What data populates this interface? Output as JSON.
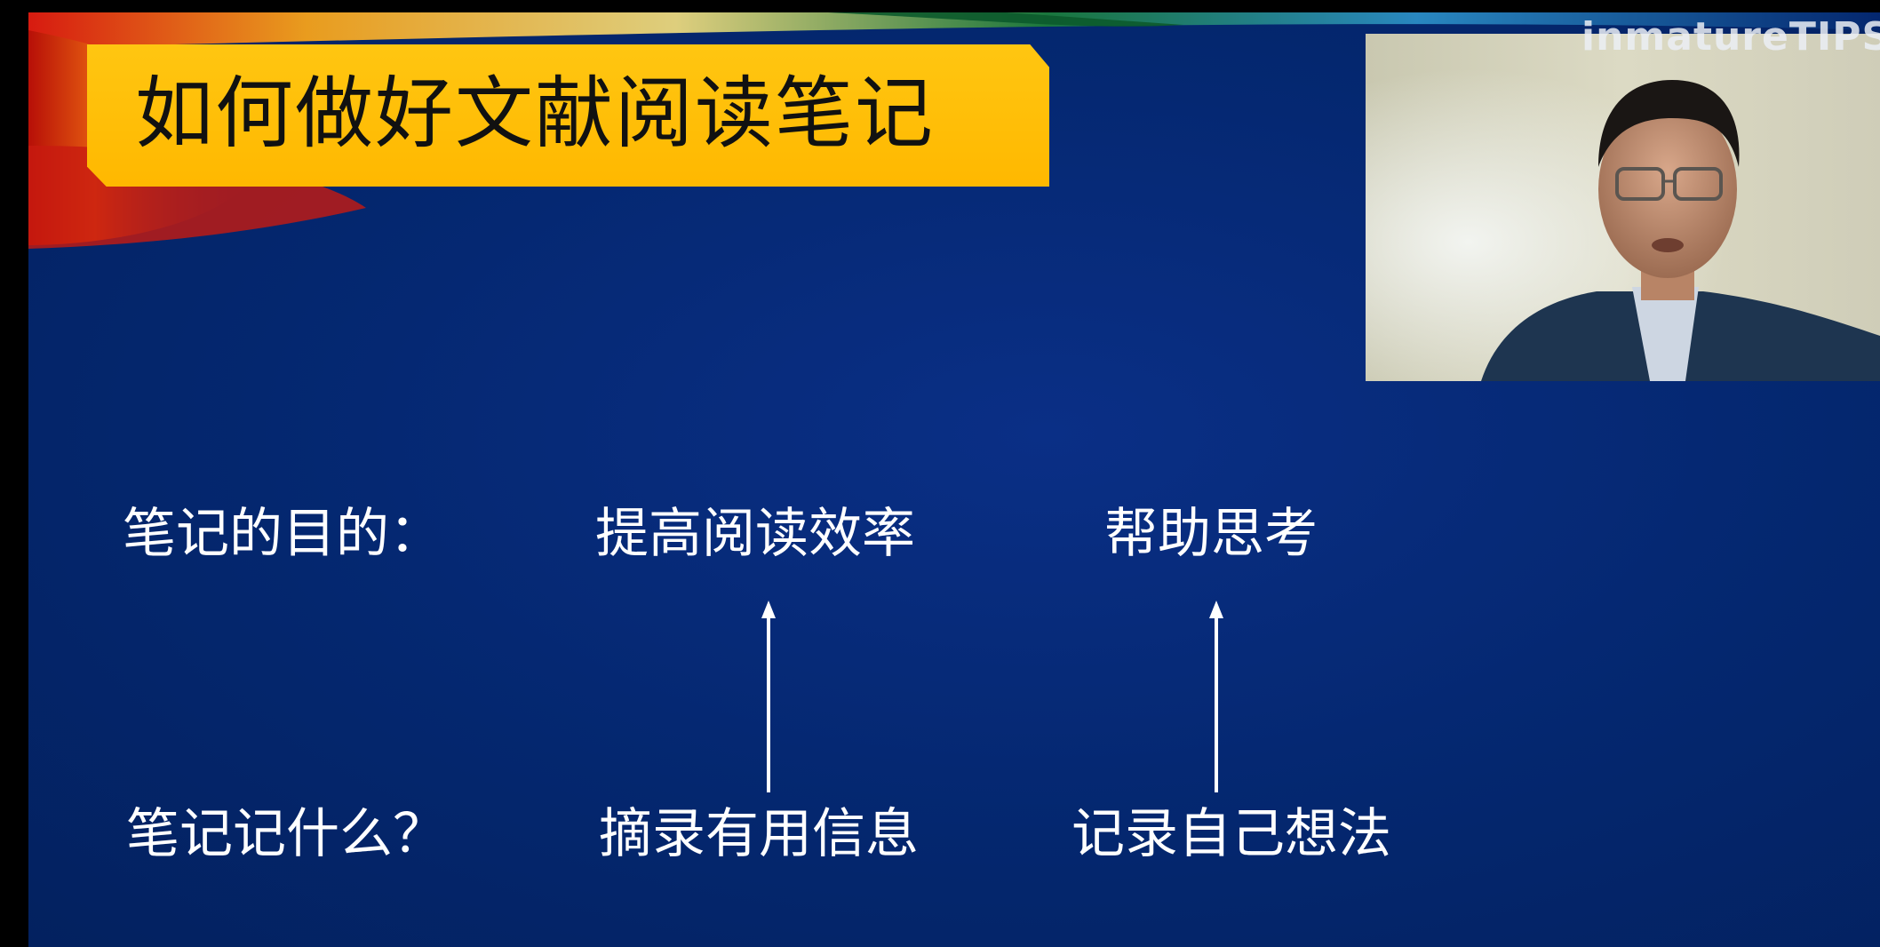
{
  "slide": {
    "title": "如何做好文献阅读笔记",
    "rows": [
      {
        "label": "笔记的目的：",
        "items": [
          "提高阅读效率",
          "帮助思考"
        ]
      },
      {
        "label": "笔记记什么？",
        "items": [
          "摘录有用信息",
          "记录自己想法"
        ]
      }
    ]
  },
  "overlay": {
    "watermark": "inmatureTIPS",
    "webcam_icon": "presenter-webcam"
  },
  "colors": {
    "slide_background": "#04276f",
    "title_banner": "#ffc000",
    "text": "#ffffff"
  }
}
